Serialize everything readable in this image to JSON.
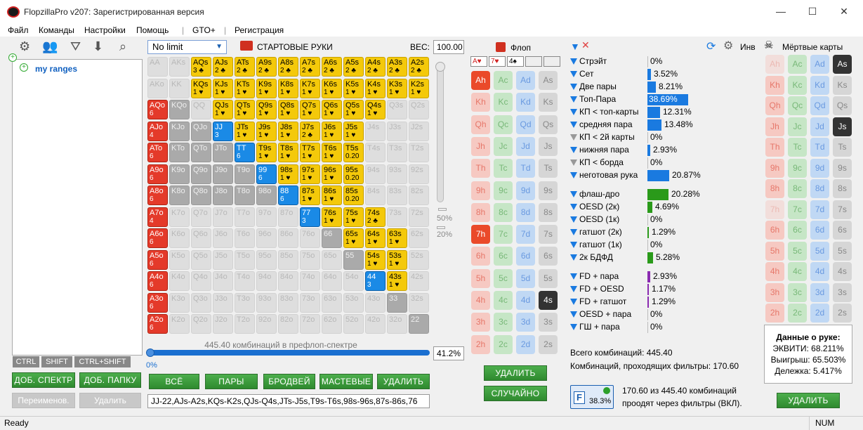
{
  "window": {
    "title": "FlopzillaPro v207: Зарегистрированная версия",
    "min": "—",
    "max": "☐",
    "close": "✕"
  },
  "menu": [
    "Файл",
    "Команды",
    "Настройки",
    "Помощь",
    "|",
    "GTO+",
    "|",
    "Регистрация"
  ],
  "tree": {
    "root_label": "my ranges",
    "plus": "+"
  },
  "modifier_keys": [
    "CTRL",
    "SHIFT",
    "CTRL+SHIFT"
  ],
  "left_buttons": {
    "add_range": "ДОБ. СПЕКТР",
    "add_folder": "ДОБ. ПАПКУ",
    "rename": "Переименов.",
    "delete": "Удалить"
  },
  "hands_panel": {
    "limit": "No limit",
    "title": "СТАРТОВЫЕ РУКИ",
    "weight_label": "ВЕС:",
    "weight_value": "100.00",
    "pct50": "50%",
    "pct20": "20%",
    "combos_text": "445.40 комбинаций в префлоп-спектре",
    "pct_value": "41.2%",
    "zero": "0%",
    "buttons": {
      "all": "ВСЁ",
      "pairs": "ПАРЫ",
      "broadway": "БРОДВЕЙ",
      "suited": "МАСТЕВЫЕ",
      "delete": "УДАЛИТЬ"
    },
    "range_text": "JJ-22,AJs-A2s,KQs-K2s,QJs-Q4s,JTs-J5s,T9s-T6s,98s-96s,87s-86s,76"
  },
  "grid": [
    [
      [
        "AA",
        "",
        "e"
      ],
      [
        "AKs",
        "",
        "e"
      ],
      [
        "AQs",
        "3 ♣",
        "y"
      ],
      [
        "AJs",
        "2 ♣",
        "y"
      ],
      [
        "ATs",
        "2 ♣",
        "y"
      ],
      [
        "A9s",
        "2 ♣",
        "y"
      ],
      [
        "A8s",
        "2 ♣",
        "y"
      ],
      [
        "A7s",
        "2 ♣",
        "y"
      ],
      [
        "A6s",
        "2 ♣",
        "y"
      ],
      [
        "A5s",
        "2 ♣",
        "y"
      ],
      [
        "A4s",
        "2 ♣",
        "y"
      ],
      [
        "A3s",
        "2 ♣",
        "y"
      ],
      [
        "A2s",
        "2 ♣",
        "y"
      ]
    ],
    [
      [
        "AKo",
        "",
        "e"
      ],
      [
        "KK",
        "",
        "e"
      ],
      [
        "KQs",
        "1 ♥",
        "y"
      ],
      [
        "KJs",
        "1 ♥",
        "y"
      ],
      [
        "KTs",
        "1 ♥",
        "y"
      ],
      [
        "K9s",
        "1 ♥",
        "y"
      ],
      [
        "K8s",
        "1 ♥",
        "y"
      ],
      [
        "K7s",
        "1 ♥",
        "y"
      ],
      [
        "K6s",
        "1 ♥",
        "y"
      ],
      [
        "K5s",
        "1 ♥",
        "y"
      ],
      [
        "K4s",
        "1 ♥",
        "y"
      ],
      [
        "K3s",
        "1 ♥",
        "y"
      ],
      [
        "K2s",
        "1 ♥",
        "y"
      ]
    ],
    [
      [
        "AQo",
        "6",
        "r"
      ],
      [
        "KQo",
        "",
        "g"
      ],
      [
        "QQ",
        "",
        "e"
      ],
      [
        "QJs",
        "1 ♥",
        "y"
      ],
      [
        "QTs",
        "1 ♥",
        "y"
      ],
      [
        "Q9s",
        "1 ♥",
        "y"
      ],
      [
        "Q8s",
        "1 ♥",
        "y"
      ],
      [
        "Q7s",
        "1 ♥",
        "y"
      ],
      [
        "Q6s",
        "1 ♥",
        "y"
      ],
      [
        "Q5s",
        "1 ♥",
        "y"
      ],
      [
        "Q4s",
        "1 ♥",
        "y"
      ],
      [
        "Q3s",
        "",
        "e"
      ],
      [
        "Q2s",
        "",
        "e"
      ]
    ],
    [
      [
        "AJo",
        "4",
        "r"
      ],
      [
        "KJo",
        "",
        "g"
      ],
      [
        "QJo",
        "",
        "g"
      ],
      [
        "JJ",
        "3",
        "b"
      ],
      [
        "JTs",
        "1 ♥",
        "y"
      ],
      [
        "J9s",
        "1 ♥",
        "y"
      ],
      [
        "J8s",
        "1 ♥",
        "y"
      ],
      [
        "J7s",
        "2 ♣",
        "y"
      ],
      [
        "J6s",
        "1 ♥",
        "y"
      ],
      [
        "J5s",
        "1 ♥",
        "y"
      ],
      [
        "J4s",
        "",
        "e"
      ],
      [
        "J3s",
        "",
        "e"
      ],
      [
        "J2s",
        "",
        "e"
      ]
    ],
    [
      [
        "ATo",
        "6",
        "r"
      ],
      [
        "KTo",
        "",
        "g"
      ],
      [
        "QTo",
        "",
        "g"
      ],
      [
        "JTo",
        "",
        "g"
      ],
      [
        "TT",
        "6",
        "b"
      ],
      [
        "T9s",
        "1 ♥",
        "y"
      ],
      [
        "T8s",
        "1 ♥",
        "y"
      ],
      [
        "T7s",
        "1 ♥",
        "y"
      ],
      [
        "T6s",
        "1 ♥",
        "y"
      ],
      [
        "T5s",
        "0.20",
        "y"
      ],
      [
        "T4s",
        "",
        "e"
      ],
      [
        "T3s",
        "",
        "e"
      ],
      [
        "T2s",
        "",
        "e"
      ]
    ],
    [
      [
        "A9o",
        "6",
        "r"
      ],
      [
        "K9o",
        "",
        "g"
      ],
      [
        "Q9o",
        "",
        "g"
      ],
      [
        "J9o",
        "",
        "g"
      ],
      [
        "T9o",
        "",
        "g"
      ],
      [
        "99",
        "6",
        "b"
      ],
      [
        "98s",
        "1 ♥",
        "y"
      ],
      [
        "97s",
        "1 ♥",
        "y"
      ],
      [
        "96s",
        "1 ♥",
        "y"
      ],
      [
        "95s",
        "0.20",
        "y"
      ],
      [
        "94s",
        "",
        "e"
      ],
      [
        "93s",
        "",
        "e"
      ],
      [
        "92s",
        "",
        "e"
      ]
    ],
    [
      [
        "A8o",
        "6",
        "r"
      ],
      [
        "K8o",
        "",
        "g"
      ],
      [
        "Q8o",
        "",
        "g"
      ],
      [
        "J8o",
        "",
        "g"
      ],
      [
        "T8o",
        "",
        "g"
      ],
      [
        "98o",
        "",
        "g"
      ],
      [
        "88",
        "6",
        "b"
      ],
      [
        "87s",
        "1 ♥",
        "y"
      ],
      [
        "86s",
        "1 ♥",
        "y"
      ],
      [
        "85s",
        "0.20",
        "y"
      ],
      [
        "84s",
        "",
        "e"
      ],
      [
        "83s",
        "",
        "e"
      ],
      [
        "82s",
        "",
        "e"
      ]
    ],
    [
      [
        "A7o",
        "4",
        "r"
      ],
      [
        "K7o",
        "",
        "e"
      ],
      [
        "Q7o",
        "",
        "e"
      ],
      [
        "J7o",
        "",
        "e"
      ],
      [
        "T7o",
        "",
        "e"
      ],
      [
        "97o",
        "",
        "e"
      ],
      [
        "87o",
        "",
        "e"
      ],
      [
        "77",
        "3",
        "b"
      ],
      [
        "76s",
        "1 ♥",
        "y"
      ],
      [
        "75s",
        "1 ♥",
        "y"
      ],
      [
        "74s",
        "2 ♣",
        "y"
      ],
      [
        "73s",
        "",
        "e"
      ],
      [
        "72s",
        "",
        "e"
      ]
    ],
    [
      [
        "A6o",
        "6",
        "r"
      ],
      [
        "K6o",
        "",
        "e"
      ],
      [
        "Q6o",
        "",
        "e"
      ],
      [
        "J6o",
        "",
        "e"
      ],
      [
        "T6o",
        "",
        "e"
      ],
      [
        "96o",
        "",
        "e"
      ],
      [
        "86o",
        "",
        "e"
      ],
      [
        "76o",
        "",
        "e"
      ],
      [
        "66",
        "",
        "g"
      ],
      [
        "65s",
        "1 ♥",
        "y"
      ],
      [
        "64s",
        "1 ♥",
        "y"
      ],
      [
        "63s",
        "1 ♥",
        "y"
      ],
      [
        "62s",
        "",
        "e"
      ]
    ],
    [
      [
        "A5o",
        "6",
        "r"
      ],
      [
        "K5o",
        "",
        "e"
      ],
      [
        "Q5o",
        "",
        "e"
      ],
      [
        "J5o",
        "",
        "e"
      ],
      [
        "T5o",
        "",
        "e"
      ],
      [
        "95o",
        "",
        "e"
      ],
      [
        "85o",
        "",
        "e"
      ],
      [
        "75o",
        "",
        "e"
      ],
      [
        "65o",
        "",
        "e"
      ],
      [
        "55",
        "",
        "g"
      ],
      [
        "54s",
        "1 ♥",
        "y"
      ],
      [
        "53s",
        "1 ♥",
        "y"
      ],
      [
        "52s",
        "",
        "e"
      ]
    ],
    [
      [
        "A4o",
        "6",
        "r"
      ],
      [
        "K4o",
        "",
        "e"
      ],
      [
        "Q4o",
        "",
        "e"
      ],
      [
        "J4o",
        "",
        "e"
      ],
      [
        "T4o",
        "",
        "e"
      ],
      [
        "94o",
        "",
        "e"
      ],
      [
        "84o",
        "",
        "e"
      ],
      [
        "74o",
        "",
        "e"
      ],
      [
        "64o",
        "",
        "e"
      ],
      [
        "54o",
        "",
        "e"
      ],
      [
        "44",
        "3",
        "b"
      ],
      [
        "43s",
        "1 ♥",
        "y"
      ],
      [
        "42s",
        "",
        "e"
      ]
    ],
    [
      [
        "A3o",
        "6",
        "r"
      ],
      [
        "K3o",
        "",
        "e"
      ],
      [
        "Q3o",
        "",
        "e"
      ],
      [
        "J3o",
        "",
        "e"
      ],
      [
        "T3o",
        "",
        "e"
      ],
      [
        "93o",
        "",
        "e"
      ],
      [
        "83o",
        "",
        "e"
      ],
      [
        "73o",
        "",
        "e"
      ],
      [
        "63o",
        "",
        "e"
      ],
      [
        "53o",
        "",
        "e"
      ],
      [
        "43o",
        "",
        "e"
      ],
      [
        "33",
        "",
        "g"
      ],
      [
        "32s",
        "",
        "e"
      ]
    ],
    [
      [
        "A2o",
        "6",
        "r"
      ],
      [
        "K2o",
        "",
        "e"
      ],
      [
        "Q2o",
        "",
        "e"
      ],
      [
        "J2o",
        "",
        "e"
      ],
      [
        "T2o",
        "",
        "e"
      ],
      [
        "92o",
        "",
        "e"
      ],
      [
        "82o",
        "",
        "e"
      ],
      [
        "72o",
        "",
        "e"
      ],
      [
        "62o",
        "",
        "e"
      ],
      [
        "52o",
        "",
        "e"
      ],
      [
        "42o",
        "",
        "e"
      ],
      [
        "32o",
        "",
        "e"
      ],
      [
        "22",
        "",
        "g"
      ]
    ]
  ],
  "flop": {
    "title": "Флоп",
    "cards_shown": [
      "A♥",
      "7♥",
      "4♠"
    ],
    "selected": [
      "Ah",
      "7h",
      "4s"
    ],
    "delete": "УДАЛИТЬ",
    "random": "СЛУЧАЙНО",
    "ranks": [
      "A",
      "K",
      "Q",
      "J",
      "T",
      "9",
      "8",
      "7",
      "6",
      "5",
      "4",
      "3",
      "2"
    ],
    "suits": [
      "h",
      "c",
      "d",
      "s"
    ]
  },
  "filters": {
    "inv_label": "Инв",
    "groups": [
      [
        [
          "Стрэйт",
          "0%",
          0,
          "b"
        ],
        [
          "Сет",
          "3.52%",
          3.52,
          "b"
        ],
        [
          "Две пары",
          "8.21%",
          8.21,
          "b"
        ],
        [
          "Топ-Пара",
          "38.69%",
          38.69,
          "b"
        ],
        [
          "КП < топ-карты",
          "12.31%",
          12.31,
          "b"
        ],
        [
          "средняя пара",
          "13.48%",
          13.48,
          "b"
        ],
        [
          "КП < 2й карты",
          "0%",
          0,
          "g"
        ],
        [
          "нижняя пара",
          "2.93%",
          2.93,
          "b"
        ],
        [
          "КП < борда",
          "0%",
          0,
          "g"
        ],
        [
          "неготовая рука",
          "20.87%",
          20.87,
          "b"
        ]
      ],
      [
        [
          "флаш-дро",
          "20.28%",
          20.28,
          "gr"
        ],
        [
          "OESD (2к)",
          "4.69%",
          4.69,
          "gr"
        ],
        [
          "OESD (1к)",
          "0%",
          0,
          "gr"
        ],
        [
          "гатшот (2к)",
          "1.29%",
          1.29,
          "gr"
        ],
        [
          "гатшот (1к)",
          "0%",
          0,
          "gr"
        ],
        [
          "2к БДФД",
          "5.28%",
          5.28,
          "gr"
        ]
      ],
      [
        [
          "FD + пара",
          "2.93%",
          2.93,
          "p"
        ],
        [
          "FD + OESD",
          "1.17%",
          1.17,
          "p"
        ],
        [
          "FD + гатшот",
          "1.29%",
          1.29,
          "p"
        ],
        [
          "OESD + пара",
          "0%",
          0,
          "p"
        ],
        [
          "ГШ + пара",
          "0%",
          0,
          "p"
        ]
      ]
    ],
    "total_combos": "Всего комбинаций: 445.40",
    "passing_combos": "Комбинаций, проходящих фильтры: 170.60",
    "filter_pct": "38.3%",
    "filter_text1": "170.60 из 445.40 комбинаций",
    "filter_text2": "проодят через фильтры (ВКЛ)."
  },
  "dead_cards": {
    "title": "Мёртвые карты",
    "selected": [
      "As",
      "Js"
    ],
    "delete": "УДАЛИТЬ"
  },
  "hand_data": {
    "title": "Данные о руке:",
    "equity": "ЭКВИТИ: 68.211%",
    "win": "Выигрыш: 65.503%",
    "tie": "Дележка: 5.417%"
  },
  "status": {
    "left": "Ready",
    "num": "NUM"
  },
  "colors": {
    "accent": "#1a7ae0",
    "green": "#2f8a2f",
    "yellow": "#f4c90a",
    "red": "#e43a2a"
  }
}
